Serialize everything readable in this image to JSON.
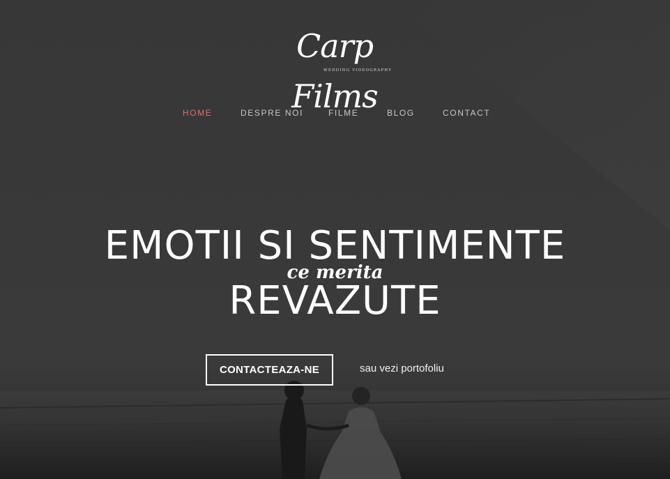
{
  "logo": {
    "script_text": "Carp Films",
    "tagline": "WEDDING VIDEOGRAPHY"
  },
  "nav": {
    "items": [
      {
        "label": "HOME",
        "active": true
      },
      {
        "label": "DESPRE NOI",
        "active": false
      },
      {
        "label": "FILME",
        "active": false
      },
      {
        "label": "BLOG",
        "active": false
      },
      {
        "label": "CONTACT",
        "active": false
      }
    ]
  },
  "hero": {
    "line1": "EMOTII SI SENTIMENTE",
    "line2": "ce merita",
    "line3": "REVAZUTE",
    "cta_label": "CONTACTEAZA-NE",
    "secondary_link": "sau vezi portofoliu"
  },
  "colors": {
    "accent": "#e06f6a",
    "overlay": "#3a3a3a",
    "text": "#ffffff"
  }
}
